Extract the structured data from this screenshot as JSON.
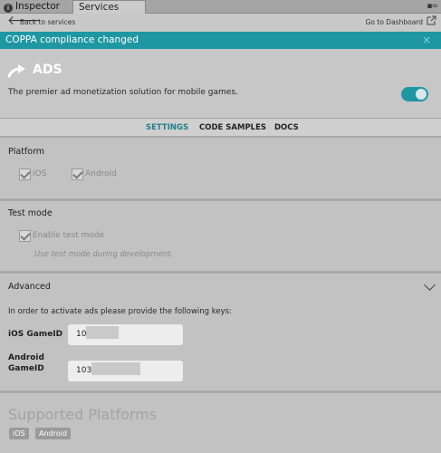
{
  "tabs": {
    "inspector": "Inspector",
    "services": "Services"
  },
  "toolbar": {
    "back_label": "Back to services",
    "dashboard_label": "Go to Dashboard"
  },
  "banner": {
    "message": "COPPA compliance changed",
    "close": "×"
  },
  "service": {
    "title": "ADS",
    "description": "The premier ad monetization solution for mobile games.",
    "enabled": true,
    "accent_color": "#1f97a3"
  },
  "nav": {
    "settings": "SETTINGS",
    "code_samples": "CODE SAMPLES",
    "docs": "DOCS",
    "active": "settings"
  },
  "platform": {
    "title": "Platform",
    "ios_label": "iOS",
    "ios_checked": true,
    "android_label": "Android",
    "android_checked": true
  },
  "test_mode": {
    "title": "Test mode",
    "enable_label": "Enable test mode",
    "enable_checked": true,
    "hint": "Use test mode during development."
  },
  "advanced": {
    "title": "Advanced",
    "instructions": "In order to activate ads please provide the following keys:",
    "ios_gameid_label": "iOS GameID",
    "ios_gameid_value": "10",
    "android_gameid_label_line1": "Android",
    "android_gameid_label_line2": "GameID",
    "android_gameid_value": "103"
  },
  "supported": {
    "title": "Supported Platforms",
    "platforms": [
      "iOS",
      "Android"
    ]
  }
}
